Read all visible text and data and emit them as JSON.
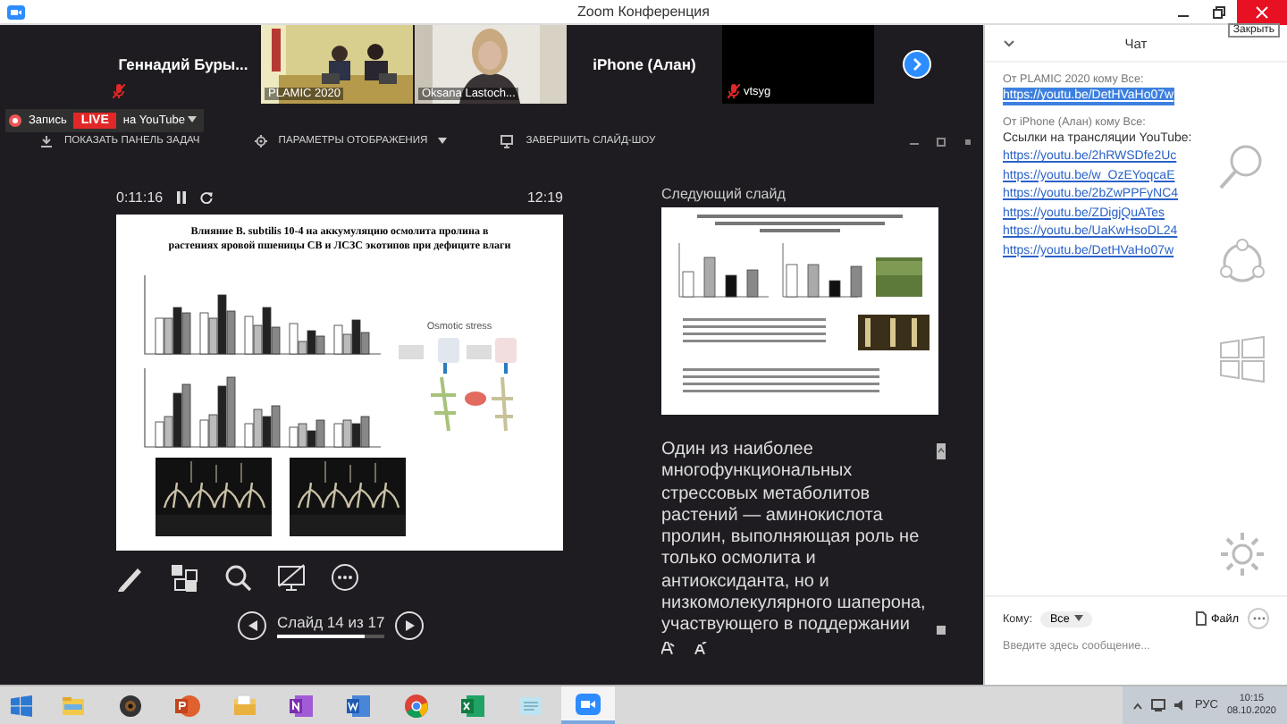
{
  "window": {
    "title": "Zoom Конференция",
    "tooltip": "Закрыть"
  },
  "video_strip": {
    "tiles": [
      {
        "kind": "name",
        "name": "Геннадий Буры...",
        "muted": true
      },
      {
        "kind": "video",
        "name": "PLAMIC 2020",
        "muted": false
      },
      {
        "kind": "video",
        "name": "Oksana Lastoch...",
        "muted": false
      },
      {
        "kind": "name",
        "name": "iPhone (Алан)",
        "muted": false
      },
      {
        "kind": "blank",
        "name": "vtsyg",
        "muted": true
      }
    ]
  },
  "broadcast": {
    "record": "Запись",
    "live": "LIVE",
    "target": "на YouTube"
  },
  "toolbar": [
    {
      "kind": "taskbar",
      "label": "ПОКАЗАТЬ ПАНЕЛЬ ЗАДАЧ",
      "dropdown": false
    },
    {
      "kind": "display",
      "label": "ПАРАМЕТРЫ ОТОБРАЖЕНИЯ",
      "dropdown": true
    },
    {
      "kind": "end",
      "label": "ЗАВЕРШИТЬ СЛАЙД-ШОУ",
      "dropdown": false
    }
  ],
  "presenter": {
    "elapsed": "0:11:16",
    "clock": "12:19",
    "slide": {
      "title": "Влияние B. subtilis 10-4 на аккумуляцию осмолита пролина в растениях яровой пшеницы СВ и ЛСЗС экотипов при дефиците влаги",
      "diagram_label": "Osmotic stress"
    },
    "tools": [
      {
        "kind": "pen"
      },
      {
        "kind": "slides"
      },
      {
        "kind": "zoom"
      },
      {
        "kind": "screen"
      },
      {
        "kind": "more"
      }
    ],
    "nav": {
      "label": "Слайд 14 из 17",
      "level": 0.82
    },
    "next_label": "Следующий слайд",
    "notes": "Один из наиболее многофункциональных стрессовых метаболитов растений — аминокислота пролин, выполняющая роль не только осмолита и антиоксиданта, но и низкомолекулярного шаперона, участвующего в поддержании"
  },
  "chat": {
    "title": "Чат",
    "messages": [
      {
        "header": "От PLAMIC 2020 кому Все:",
        "lines": [
          {
            "kind": "link",
            "text": "https://youtu.be/DetHVaHo07w",
            "highlighted": true
          }
        ]
      },
      {
        "header": "От iPhone (Алан) кому Все:",
        "lines": [
          {
            "kind": "text",
            "text": "Ссылки на трансляции YouTube:",
            "highlighted": false
          },
          {
            "kind": "link",
            "text": "https://youtu.be/2hRWSDfe2Uc",
            "highlighted": false
          },
          {
            "kind": "link",
            "text": "https://youtu.be/w_OzEYoqcaE",
            "highlighted": false
          },
          {
            "kind": "link",
            "text": "https://youtu.be/2bZwPPFyNC4",
            "highlighted": false
          },
          {
            "kind": "link",
            "text": "https://youtu.be/ZDigjQuATes",
            "highlighted": false
          },
          {
            "kind": "link",
            "text": "https://youtu.be/UaKwHsoDL24",
            "highlighted": false
          },
          {
            "kind": "link",
            "text": "https://youtu.be/DetHVaHo07w",
            "highlighted": false
          }
        ]
      }
    ],
    "to_label": "Кому:",
    "to_value": "Все",
    "file": "Файл",
    "placeholder": "Введите здесь сообщение..."
  },
  "taskbar": {
    "apps": [
      {
        "kind": "explorer",
        "active": false
      },
      {
        "kind": "camera",
        "active": false
      },
      {
        "kind": "powerpoint",
        "active": false
      },
      {
        "kind": "folder",
        "active": false
      },
      {
        "kind": "onenote",
        "active": false
      },
      {
        "kind": "word",
        "active": false
      },
      {
        "kind": "chrome",
        "active": false
      },
      {
        "kind": "excel",
        "active": false
      },
      {
        "kind": "notes",
        "active": false
      },
      {
        "kind": "zoom",
        "active": true
      }
    ],
    "language": "РУС",
    "time": "10:15",
    "date": "08.10.2020"
  }
}
